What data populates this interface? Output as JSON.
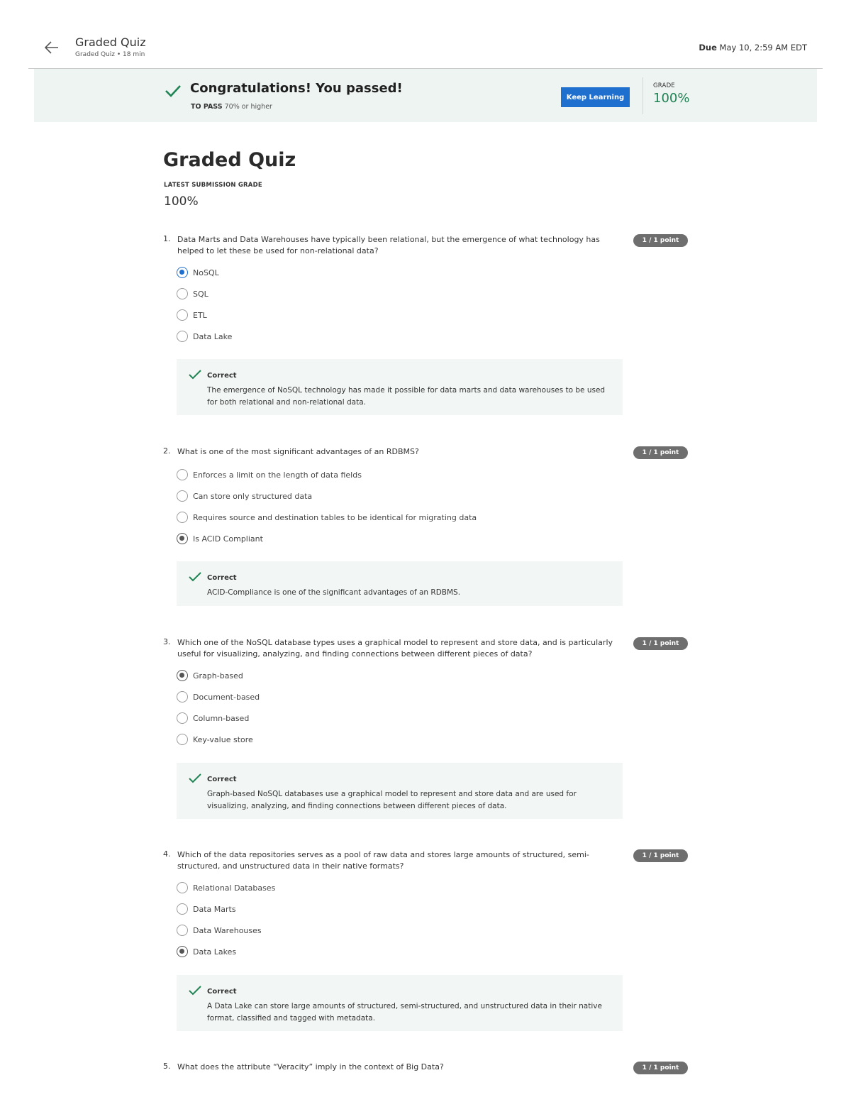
{
  "header": {
    "title": "Graded Quiz",
    "subtitle": "Graded Quiz • 18 min",
    "due_label": "Due",
    "due_value": "May 10, 2:59 AM EDT"
  },
  "banner": {
    "message": "Congratulations! You passed!",
    "to_pass_label": "TO PASS",
    "to_pass_value": "70% or higher",
    "button": "Keep Learning",
    "grade_label": "GRADE",
    "grade_value": "100%"
  },
  "main": {
    "title": "Graded Quiz",
    "latest_label": "LATEST SUBMISSION GRADE",
    "latest_value": "100%"
  },
  "questions": [
    {
      "number": "1.",
      "text": "Data Marts and Data Warehouses have typically been relational, but the emergence of what technology has helped to let these be used for non-relational data?",
      "points": "1 / 1 point",
      "options": [
        "NoSQL",
        "SQL",
        "ETL",
        "Data Lake"
      ],
      "selected": 0,
      "feedback_title": "Correct",
      "feedback_text": "The emergence of NoSQL technology has made it possible for data marts and data warehouses to be used for both relational and non-relational data."
    },
    {
      "number": "2.",
      "text": "What is one of the most significant advantages of an RDBMS?",
      "points": "1 / 1 point",
      "options": [
        "Enforces a limit on the length of data fields",
        "Can store only structured data",
        "Requires source and destination tables to be identical for migrating data",
        "Is ACID Compliant"
      ],
      "selected": 3,
      "feedback_title": "Correct",
      "feedback_text": "ACID-Compliance is one of the significant advantages of an RDBMS."
    },
    {
      "number": "3.",
      "text": "Which one of the NoSQL database types uses a graphical model to represent and store data, and is particularly useful for visualizing, analyzing, and finding connections between different pieces of data?",
      "points": "1 / 1 point",
      "options": [
        "Graph-based",
        "Document-based",
        "Column-based",
        "Key-value store"
      ],
      "selected": 0,
      "feedback_title": "Correct",
      "feedback_text": "Graph-based NoSQL databases use a graphical model to represent and store data and are used for visualizing, analyzing, and finding connections between different pieces of data."
    },
    {
      "number": "4.",
      "text": "Which of the data repositories serves as a pool of raw data and stores large amounts of structured, semi-structured, and unstructured data in their native formats?",
      "points": "1 / 1 point",
      "options": [
        "Relational Databases",
        "Data Marts",
        "Data Warehouses",
        "Data Lakes"
      ],
      "selected": 3,
      "feedback_title": "Correct",
      "feedback_text": "A Data Lake can store large amounts of structured, semi-structured, and unstructured data in their native format, classified and tagged with metadata."
    },
    {
      "number": "5.",
      "text": "What does the attribute “Veracity” imply in the context of Big Data?",
      "points": "1 / 1 point",
      "options": [],
      "selected": -1,
      "feedback_title": "",
      "feedback_text": ""
    }
  ]
}
